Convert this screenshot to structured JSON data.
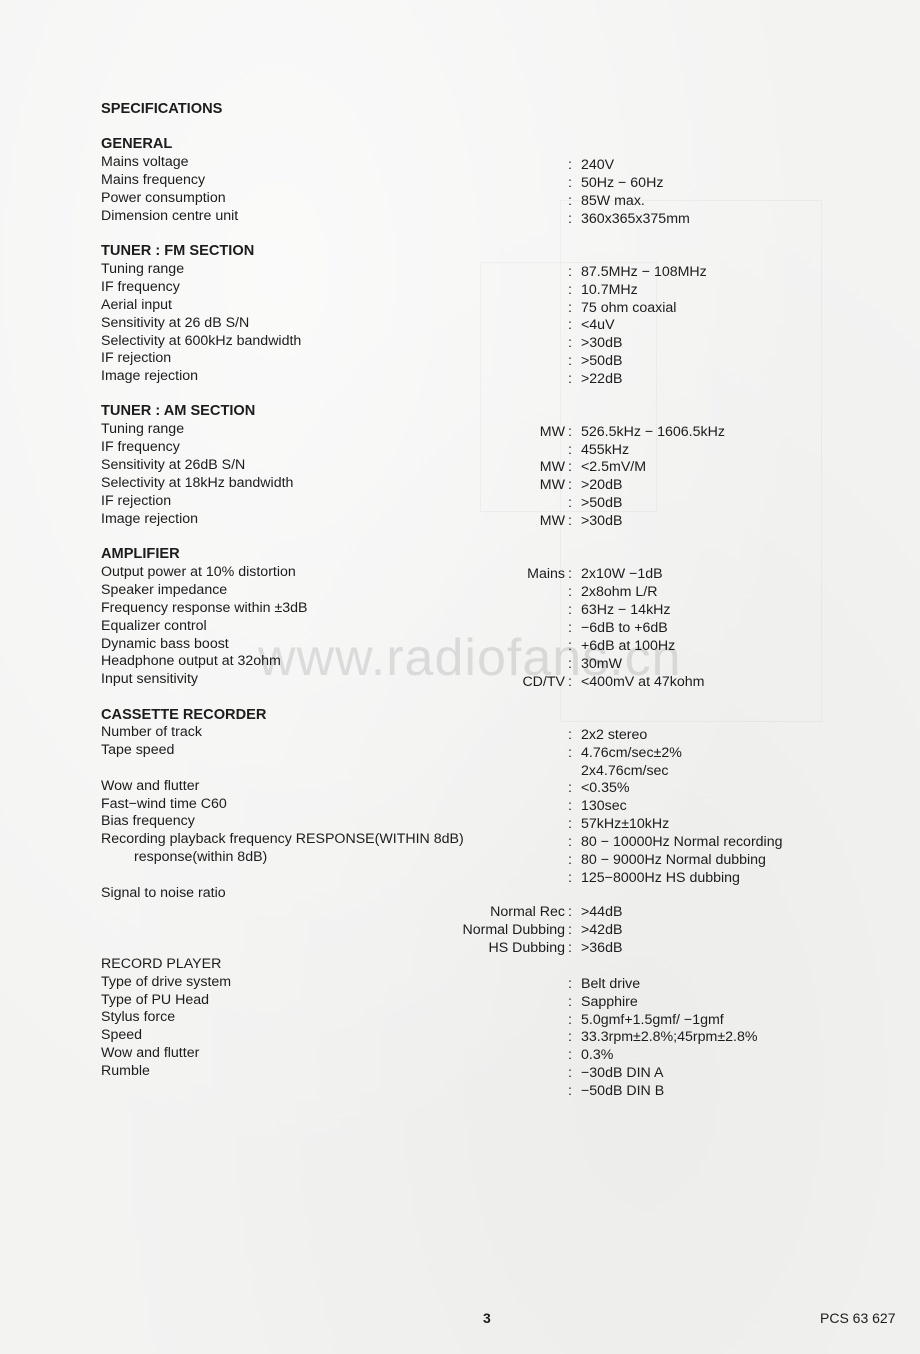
{
  "document": {
    "title": "SPECIFICATIONS",
    "watermark": "www.radiofans.cn",
    "sections": [
      {
        "heading": "GENERAL",
        "rows": [
          {
            "label": "Mains voltage",
            "prefix": "",
            "value": "240V"
          },
          {
            "label": "Mains frequency",
            "prefix": "",
            "value": "50Hz − 60Hz"
          },
          {
            "label": "Power consumption",
            "prefix": "",
            "value": "85W max."
          },
          {
            "label": "Dimension centre unit",
            "prefix": "",
            "value": "360x365x375mm"
          }
        ]
      },
      {
        "heading": "TUNER : FM SECTION",
        "rows": [
          {
            "label": "Tuning range",
            "prefix": "",
            "value": "87.5MHz − 108MHz"
          },
          {
            "label": "IF frequency",
            "prefix": "",
            "value": "10.7MHz"
          },
          {
            "label": "Aerial input",
            "prefix": "",
            "value": "75 ohm coaxial"
          },
          {
            "label": "Sensitivity at 26 dB S/N",
            "prefix": "",
            "value": "<4uV"
          },
          {
            "label": "Selectivity at 600kHz bandwidth",
            "prefix": "",
            "value": ">30dB"
          },
          {
            "label": "IF rejection",
            "prefix": "",
            "value": ">50dB"
          },
          {
            "label": "Image rejection",
            "prefix": "",
            "value": ">22dB"
          }
        ]
      },
      {
        "heading": "TUNER : AM SECTION",
        "rows": [
          {
            "label": "Tuning range",
            "prefix": "MW",
            "value": "526.5kHz − 1606.5kHz"
          },
          {
            "label": "IF frequency",
            "prefix": "",
            "value": "455kHz"
          },
          {
            "label": "Sensitivity at 26dB S/N",
            "prefix": "MW",
            "value": "<2.5mV/M"
          },
          {
            "label": "Selectivity at 18kHz bandwidth",
            "prefix": "MW",
            "value": ">20dB"
          },
          {
            "label": "IF rejection",
            "prefix": "",
            "value": ">50dB"
          },
          {
            "label": "Image rejection",
            "prefix": "MW",
            "value": ">30dB"
          }
        ]
      },
      {
        "heading": "AMPLIFIER",
        "rows": [
          {
            "label": "Output power at 10% distortion",
            "prefix": "Mains",
            "value": "2x10W −1dB"
          },
          {
            "label": "Speaker impedance",
            "prefix": "",
            "value": "2x8ohm L/R"
          },
          {
            "label": "Frequency response within ±3dB",
            "prefix": "",
            "value": "63Hz − 14kHz"
          },
          {
            "label": "Equalizer control",
            "prefix": "",
            "value": "−6dB to +6dB"
          },
          {
            "label": "Dynamic bass boost",
            "prefix": "",
            "value": "+6dB at 100Hz"
          },
          {
            "label": "Headphone output at 32ohm",
            "prefix": "",
            "value": "30mW"
          },
          {
            "label": "Input sensitivity",
            "prefix": "CD/TV",
            "value": "<400mV at 47kohm"
          }
        ]
      }
    ],
    "cassette": {
      "heading": "CASSETTE RECORDER",
      "labels": [
        "Number of track",
        "Tape speed",
        "Wow and flutter",
        "Fast−wind time C60",
        "Bias frequency",
        "Recording playback frequency RESPONSE(WITHIN 8dB)",
        "response(within 8dB)",
        "Signal to noise ratio"
      ],
      "values": [
        {
          "prefix": "",
          "colon": true,
          "value": "2x2 stereo"
        },
        {
          "prefix": "",
          "colon": true,
          "value": "4.76cm/sec±2%"
        },
        {
          "prefix": "",
          "colon": false,
          "value": "2x4.76cm/sec"
        },
        {
          "prefix": "",
          "colon": true,
          "value": "<0.35%"
        },
        {
          "prefix": "",
          "colon": true,
          "value": "130sec"
        },
        {
          "prefix": "",
          "colon": true,
          "value": "57kHz±10kHz"
        },
        {
          "prefix": "",
          "colon": true,
          "value": "80 − 10000Hz Normal recording"
        },
        {
          "prefix": "",
          "colon": true,
          "value": "80 − 9000Hz Normal dubbing"
        },
        {
          "prefix": "",
          "colon": true,
          "value": "125−8000Hz HS dubbing"
        },
        {
          "prefix": "Normal Rec",
          "colon": true,
          "value": ">44dB"
        },
        {
          "prefix": "Normal Dubbing",
          "colon": true,
          "value": ">42dB"
        },
        {
          "prefix": "HS Dubbing",
          "colon": true,
          "value": ">36dB"
        }
      ]
    },
    "record_player": {
      "heading": "RECORD PLAYER",
      "labels": [
        "Type of drive system",
        "Type of PU Head",
        "Stylus force",
        "Speed",
        "Wow and flutter",
        "Rumble"
      ],
      "values": [
        "Belt drive",
        "Sapphire",
        "5.0gmf+1.5gmf/ −1gmf",
        "33.3rpm±2.8%;45rpm±2.8%",
        "0.3%",
        "−30dB DIN A",
        "−50dB DIN B"
      ]
    },
    "footer": {
      "page_number": "3",
      "model": "PCS 63 627"
    },
    "colon": ":"
  }
}
